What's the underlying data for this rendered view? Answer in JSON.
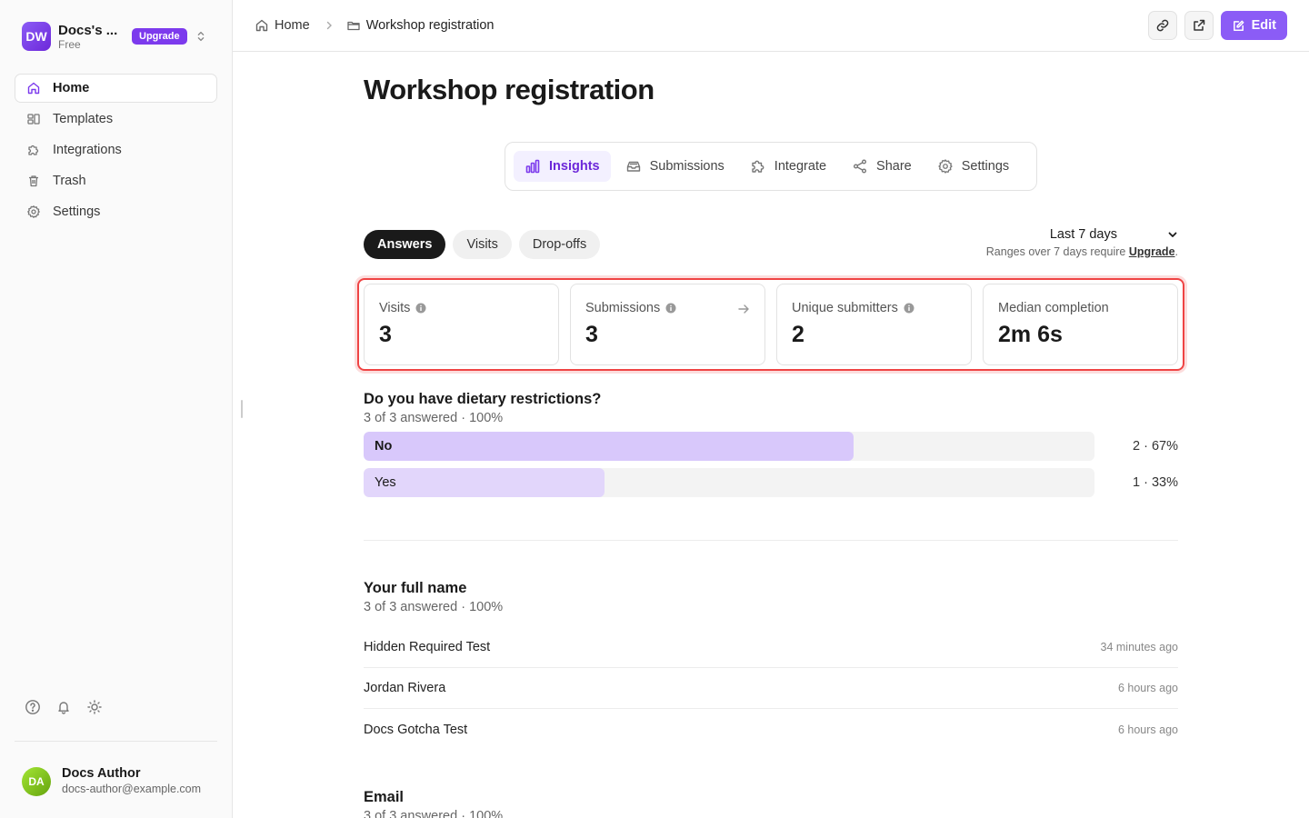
{
  "workspace": {
    "initials": "DW",
    "name": "Docs's ...",
    "plan": "Free",
    "upgrade_label": "Upgrade"
  },
  "nav": [
    {
      "label": "Home",
      "icon": "home-icon",
      "active": true
    },
    {
      "label": "Templates",
      "icon": "templates-icon"
    },
    {
      "label": "Integrations",
      "icon": "puzzle-icon"
    },
    {
      "label": "Trash",
      "icon": "trash-icon"
    },
    {
      "label": "Settings",
      "icon": "gear-icon"
    }
  ],
  "user": {
    "initials": "DA",
    "name": "Docs Author",
    "email": "docs-author@example.com"
  },
  "breadcrumb": {
    "home": "Home",
    "current": "Workshop registration"
  },
  "toolbar": {
    "edit_label": "Edit"
  },
  "page": {
    "title": "Workshop registration"
  },
  "tabs": [
    {
      "label": "Insights",
      "icon": "bar-chart-icon",
      "active": true
    },
    {
      "label": "Submissions",
      "icon": "inbox-icon"
    },
    {
      "label": "Integrate",
      "icon": "puzzle-icon"
    },
    {
      "label": "Share",
      "icon": "share-icon"
    },
    {
      "label": "Settings",
      "icon": "gear-icon"
    }
  ],
  "view_pills": [
    {
      "label": "Answers",
      "active": true
    },
    {
      "label": "Visits"
    },
    {
      "label": "Drop-offs"
    }
  ],
  "range": {
    "selected": "Last 7 days",
    "note_prefix": "Ranges over 7 days require ",
    "note_link": "Upgrade",
    "note_suffix": "."
  },
  "stats": [
    {
      "label": "Visits",
      "value": "3",
      "info": true
    },
    {
      "label": "Submissions",
      "value": "3",
      "info": true,
      "arrow": true
    },
    {
      "label": "Unique submitters",
      "value": "2",
      "info": true
    },
    {
      "label": "Median completion",
      "value": "2m 6s"
    }
  ],
  "question1": {
    "title": "Do you have dietary restrictions?",
    "summary": "3 of 3 answered · 100%",
    "options": [
      {
        "label": "No",
        "value_text": "2 · 67%",
        "fraction": 0.67,
        "color": "#d8c8fb",
        "bold": true
      },
      {
        "label": "Yes",
        "value_text": "1 · 33%",
        "fraction": 0.33,
        "color": "#e2d6fb"
      }
    ]
  },
  "question2": {
    "title": "Your full name",
    "summary": "3 of 3 answered · 100%",
    "answers": [
      {
        "text": "Hidden Required Test",
        "time": "34 minutes ago"
      },
      {
        "text": "Jordan Rivera",
        "time": "6 hours ago"
      },
      {
        "text": "Docs Gotcha Test",
        "time": "6 hours ago"
      }
    ]
  },
  "question3": {
    "title": "Email",
    "summary": "3 of 3 answered · 100%"
  },
  "colors": {
    "accent": "#8b5cf6",
    "accent_dark": "#6d28d9",
    "highlight": "#ef4444"
  }
}
